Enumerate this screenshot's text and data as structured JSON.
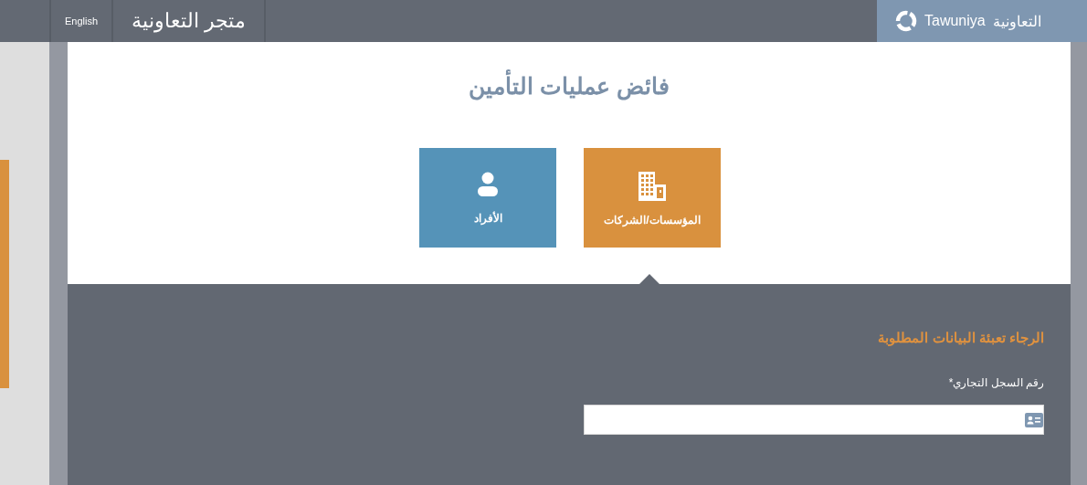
{
  "header": {
    "logo": {
      "latin": "Tawuniya",
      "arabic": "التعاونية"
    },
    "store_title": "متجر التعاونية",
    "language_link": "English"
  },
  "page": {
    "title": "فائض عمليات التأمين",
    "options": [
      {
        "label": "المؤسسات/الشركات",
        "kind": "company",
        "selected": true
      },
      {
        "label": "الأفراد",
        "kind": "person",
        "selected": false
      }
    ]
  },
  "form": {
    "heading": "الرجاء تعبئة البيانات المطلوبة",
    "fields": [
      {
        "label": "رقم السجل التجاري*"
      }
    ]
  }
}
